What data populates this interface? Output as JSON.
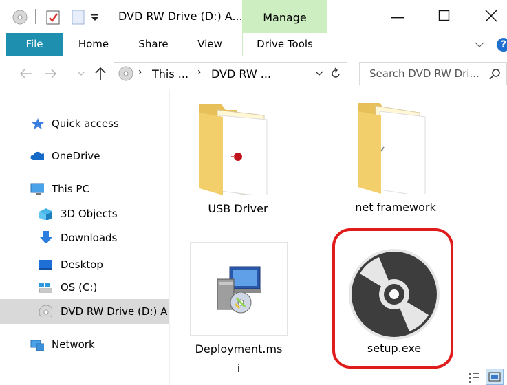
{
  "titlebar": {
    "title": "DVD RW Drive (D:) A...",
    "context_tab": "Manage",
    "controls": [
      "minimize-icon",
      "maximize-icon",
      "close-icon"
    ]
  },
  "ribbon": {
    "tabs": [
      "File",
      "Home",
      "Share",
      "View",
      "Drive Tools"
    ],
    "help": "?"
  },
  "address": {
    "path": [
      "This ...",
      "DVD RW ..."
    ],
    "search_placeholder": "Search DVD RW Dri..."
  },
  "nav": {
    "items": [
      {
        "label": "Quick access",
        "icon": "star-icon"
      },
      {
        "label": "OneDrive",
        "icon": "cloud-icon"
      },
      {
        "label": "This PC",
        "icon": "computer-icon"
      },
      {
        "label": "3D Objects",
        "icon": "cube-icon"
      },
      {
        "label": "Downloads",
        "icon": "download-arrow-icon"
      },
      {
        "label": "Desktop",
        "icon": "desktop-icon"
      },
      {
        "label": "OS (C:)",
        "icon": "drive-icon"
      },
      {
        "label": "DVD RW Drive (D:) A",
        "icon": "disc-icon"
      },
      {
        "label": "Network",
        "icon": "network-icon"
      }
    ]
  },
  "files": [
    {
      "name": "USB Driver",
      "type": "folder"
    },
    {
      "name": "net framework",
      "type": "folder"
    },
    {
      "name_line1": "Deployment.ms",
      "name_line2": "i",
      "type": "msi"
    },
    {
      "name": "setup.exe",
      "type": "exe"
    }
  ],
  "colors": {
    "file_tab": "#1f8fb0",
    "manage_tab": "#cdeec0",
    "highlight": "#e01b1b",
    "selection": "#d9d9d9"
  }
}
